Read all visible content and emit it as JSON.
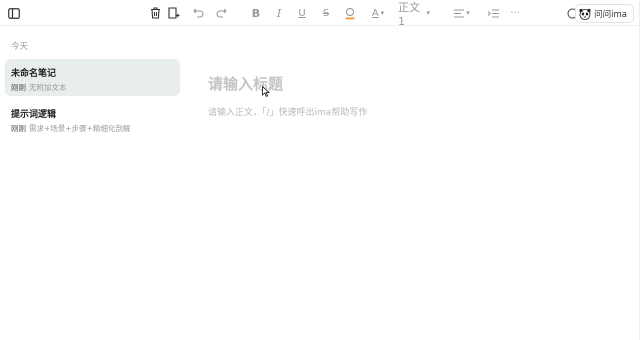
{
  "toolbar": {
    "style_label": "正文1",
    "ask_label": "问问ima",
    "more_label": "···"
  },
  "sidebar": {
    "group_label": "今天",
    "notes": [
      {
        "title": "未命名笔记",
        "time": "刚刚",
        "preview": "无附加文本"
      },
      {
        "title": "提示词逻辑",
        "time": "刚刚",
        "preview": "需求+场景+步骤+精细化剖解"
      }
    ]
  },
  "editor": {
    "title_placeholder": "请输入标题",
    "body_placeholder": "请输入正文，「/」快速呼出ima帮助写作"
  }
}
